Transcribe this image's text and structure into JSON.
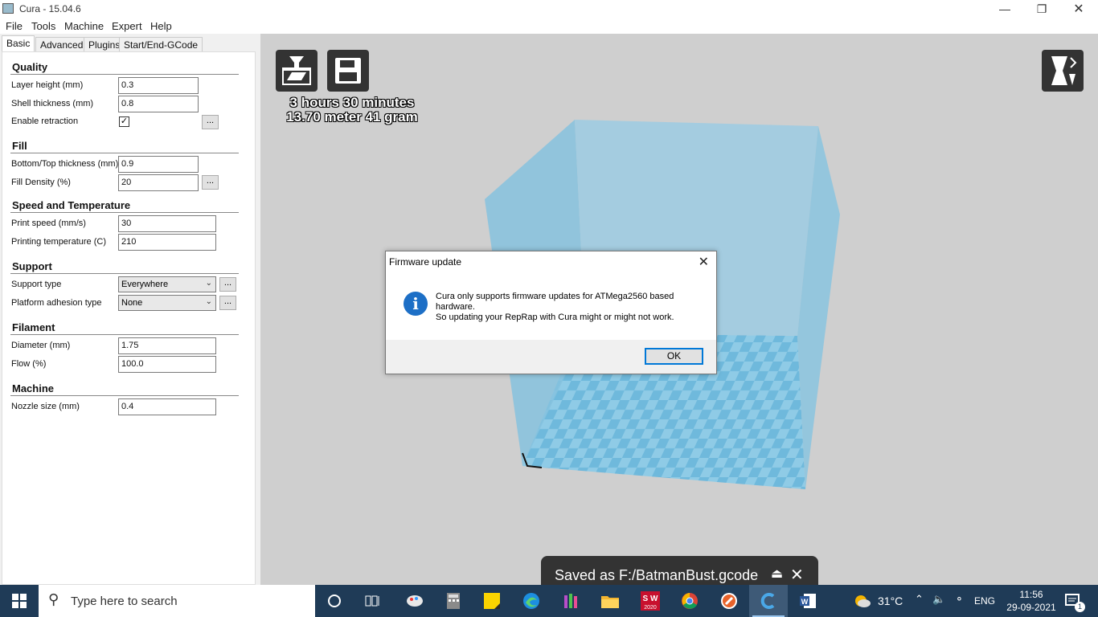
{
  "window": {
    "title": "Cura - 15.04.6"
  },
  "menu": [
    "File",
    "Tools",
    "Machine",
    "Expert",
    "Help"
  ],
  "tabs": [
    "Basic",
    "Advanced",
    "Plugins",
    "Start/End-GCode"
  ],
  "settings": {
    "quality": {
      "title": "Quality",
      "layer_height_label": "Layer height (mm)",
      "layer_height": "0.3",
      "shell_thickness_label": "Shell thickness (mm)",
      "shell_thickness": "0.8",
      "retraction_label": "Enable retraction",
      "retraction_check": "✓"
    },
    "fill": {
      "title": "Fill",
      "bottom_top_label": "Bottom/Top thickness (mm)",
      "bottom_top": "0.9",
      "density_label": "Fill Density (%)",
      "density": "20"
    },
    "speed": {
      "title": "Speed and Temperature",
      "print_speed_label": "Print speed (mm/s)",
      "print_speed": "30",
      "temp_label": "Printing temperature (C)",
      "temp": "210"
    },
    "support": {
      "title": "Support",
      "type_label": "Support type",
      "type": "Everywhere",
      "adhesion_label": "Platform adhesion type",
      "adhesion": "None"
    },
    "filament": {
      "title": "Filament",
      "diameter_label": "Diameter (mm)",
      "diameter": "1.75",
      "flow_label": "Flow (%)",
      "flow": "100.0"
    },
    "machine": {
      "title": "Machine",
      "nozzle_label": "Nozzle size (mm)",
      "nozzle": "0.4"
    },
    "dots_label": "..."
  },
  "viewport": {
    "print_time": "3 hours 30 minutes",
    "print_material": "13.70 meter 41 gram"
  },
  "dialog": {
    "title": "Firmware update",
    "message_line1": "Cura only supports firmware updates for ATMega2560 based hardware.",
    "message_line2": "So updating your RepRap with Cura might or might not work.",
    "ok_label": "OK"
  },
  "toast": {
    "message": "Saved as F:/BatmanBust.gcode"
  },
  "taskbar": {
    "search_placeholder": "Type here to search",
    "weather": "31°C",
    "language": "ENG",
    "time": "11:56",
    "date": "29-09-2021",
    "notification_count": "1",
    "sw_label": "S W",
    "sw_year": "2020"
  },
  "colors": {
    "viewport_bg": "#cfcfcf",
    "build_volume": "#7ec1e0",
    "taskbar": "#1f3b57",
    "dialog_accent": "#0078d7"
  }
}
